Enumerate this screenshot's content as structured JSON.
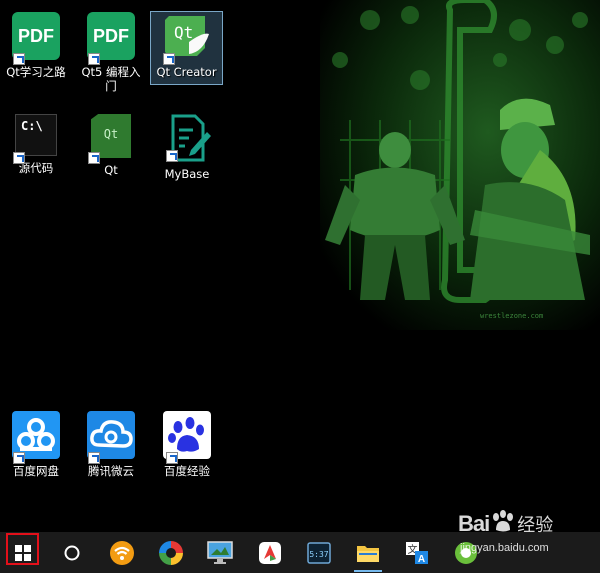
{
  "desktop": {
    "icons": [
      {
        "label": "Qt学习之路",
        "tile_text": "PDF"
      },
      {
        "label": "Qt5 编程入门",
        "tile_text": "PDF"
      },
      {
        "label": "Qt Creator",
        "tile_text": "Qt"
      },
      {
        "label": "源代码",
        "tile_text": "C:\\"
      },
      {
        "label": "Qt",
        "tile_text": "Qt"
      },
      {
        "label": "MyBase",
        "tile_text": ""
      },
      {
        "label": "百度网盘",
        "tile_text": ""
      },
      {
        "label": "腾讯微云",
        "tile_text": ""
      },
      {
        "label": "百度经验",
        "tile_text": ""
      }
    ],
    "wallpaper_credit": "wrestlezone.com"
  },
  "taskbar": {
    "clock_tile_text": "5:37",
    "colors": {
      "background": "#1b1b1b",
      "start_highlight": "#e3101a"
    }
  },
  "watermark": {
    "brand": "Bai",
    "brand_suffix": "经验",
    "url": "jingyan.baidu.com"
  }
}
